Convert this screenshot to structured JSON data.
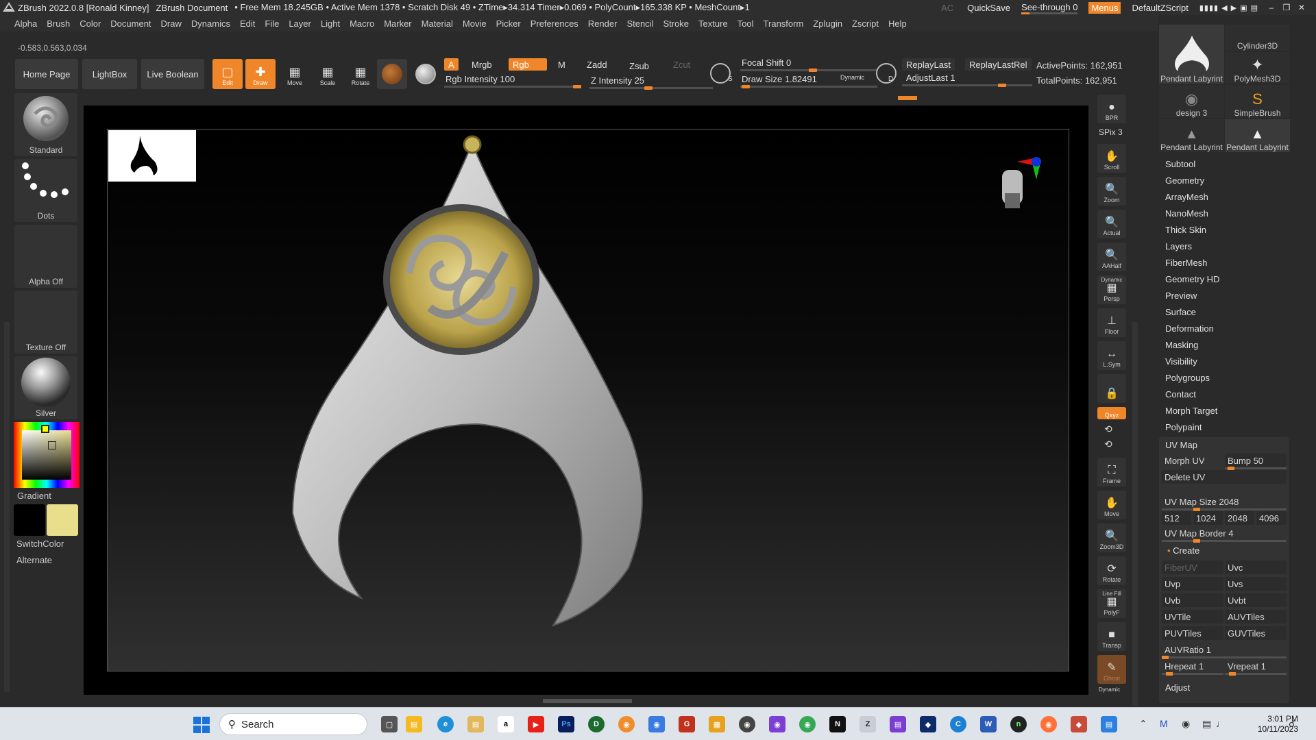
{
  "titlebar": {
    "app_title": "ZBrush 2022.0.8 [Ronald Kinney]",
    "document": "ZBrush Document",
    "stats": "• Free Mem 18.245GB • Active Mem 1378 • Scratch Disk 49 • ZTime▸34.314 Timer▸0.069 • PolyCount▸165.338 KP • MeshCount▸1",
    "ac": "AC",
    "quicksave": "QuickSave",
    "see_through": "See-through  0",
    "menus": "Menus",
    "script": "DefaultZScript",
    "minimize": "–",
    "restore": "❐",
    "close": "✕"
  },
  "menubar": [
    "Alpha",
    "Brush",
    "Color",
    "Document",
    "Draw",
    "Dynamics",
    "Edit",
    "File",
    "Layer",
    "Light",
    "Macro",
    "Marker",
    "Material",
    "Movie",
    "Picker",
    "Preferences",
    "Render",
    "Stencil",
    "Stroke",
    "Texture",
    "Tool",
    "Transform",
    "Zplugin",
    "Zscript",
    "Help"
  ],
  "coords": "-0.583,0.563,0.034",
  "shelf": {
    "home_page": "Home Page",
    "lightbox": "LightBox",
    "live_boolean": "Live Boolean",
    "edit": "Edit",
    "draw": "Draw",
    "move": "Move",
    "scale": "Scale",
    "rotate": "Rotate",
    "a": "A",
    "mrgb": "Mrgb",
    "rgb": "Rgb",
    "m": "M",
    "zadd": "Zadd",
    "zsub": "Zsub",
    "zcut": "Zcut",
    "rgb_intensity": "Rgb Intensity 100",
    "z_intensity": "Z Intensity 25",
    "focal_shift": "Focal Shift 0",
    "draw_size": "Draw Size 1.82491",
    "dynamic": "Dynamic",
    "replay_last": "ReplayLast",
    "replay_last_rel": "ReplayLastRel",
    "adjust_last": "AdjustLast 1",
    "active_points": "ActivePoints: 162,951",
    "total_points": "TotalPoints: 162,951"
  },
  "leftpanel": {
    "brush": "Standard",
    "stroke": "Dots",
    "alpha": "Alpha Off",
    "texture": "Texture Off",
    "material": "Silver",
    "gradient": "Gradient",
    "switch_color": "SwitchColor",
    "alternate": "Alternate",
    "main_color": "#000000",
    "secondary_color": "#e8de8c"
  },
  "righttools": {
    "bpr": "BPR",
    "spix": "SPix 3",
    "scroll": "Scroll",
    "zoom": "Zoom",
    "actual": "Actual",
    "aahalf": "AAHalf",
    "dynamic": "Dynamic",
    "persp": "Persp",
    "floor": "Floor",
    "lsym": "L.Sym",
    "xyz": "Qxyz",
    "frame": "Frame",
    "move": "Move",
    "zoom3d": "Zoom3D",
    "rotate": "Rotate",
    "line_fill": "Line Fill",
    "polyf": "PolyF",
    "transp": "Transp",
    "ghost": "Ghost",
    "dynamic2": "Dynamic"
  },
  "rightpanel": {
    "thumbs": [
      {
        "label": "Pendant Labyrint"
      },
      {
        "label": "Cylinder3D"
      },
      {
        "label": "PolyMesh3D"
      },
      {
        "label": "design 3"
      },
      {
        "label": "SimpleBrush"
      },
      {
        "label": "Pendant Labyrint"
      },
      {
        "label": "Pendant Labyrint"
      }
    ],
    "items": [
      "Subtool",
      "Geometry",
      "ArrayMesh",
      "NanoMesh",
      "Thick Skin",
      "Layers",
      "FiberMesh",
      "Geometry HD",
      "Preview",
      "Surface",
      "Deformation",
      "Masking",
      "Visibility",
      "Polygroups",
      "Contact",
      "Morph Target",
      "Polypaint"
    ],
    "uv_map": {
      "title": "UV Map",
      "morph_uv": "Morph UV",
      "bump": "Bump 50",
      "delete_uv": "Delete UV",
      "uv_map_size": "UV Map Size 2048",
      "sizes": [
        "512",
        "1024",
        "2048",
        "4096"
      ],
      "uv_map_border": "UV Map Border 4",
      "create": "Create",
      "fiberuv": "FiberUV",
      "uvc": "Uvc",
      "uvp": "Uvp",
      "uvs": "Uvs",
      "uvb": "Uvb",
      "uvbt": "Uvbt",
      "uvtile": "UVTile",
      "auvtiles": "AUVTiles",
      "puvtiles": "PUVTiles",
      "guvtiles": "GUVTiles",
      "auvratio": "AUVRatio 1",
      "hrepeat": "Hrepeat 1",
      "vrepeat": "Vrepeat 1",
      "adjust": "Adjust"
    }
  },
  "taskbar": {
    "search": "Search",
    "time": "3:01 PM",
    "date": "10/11/2023"
  },
  "colors": {
    "accent": "#f0862a",
    "metal": "#c9c9c9",
    "gold": "#c8b45a"
  }
}
